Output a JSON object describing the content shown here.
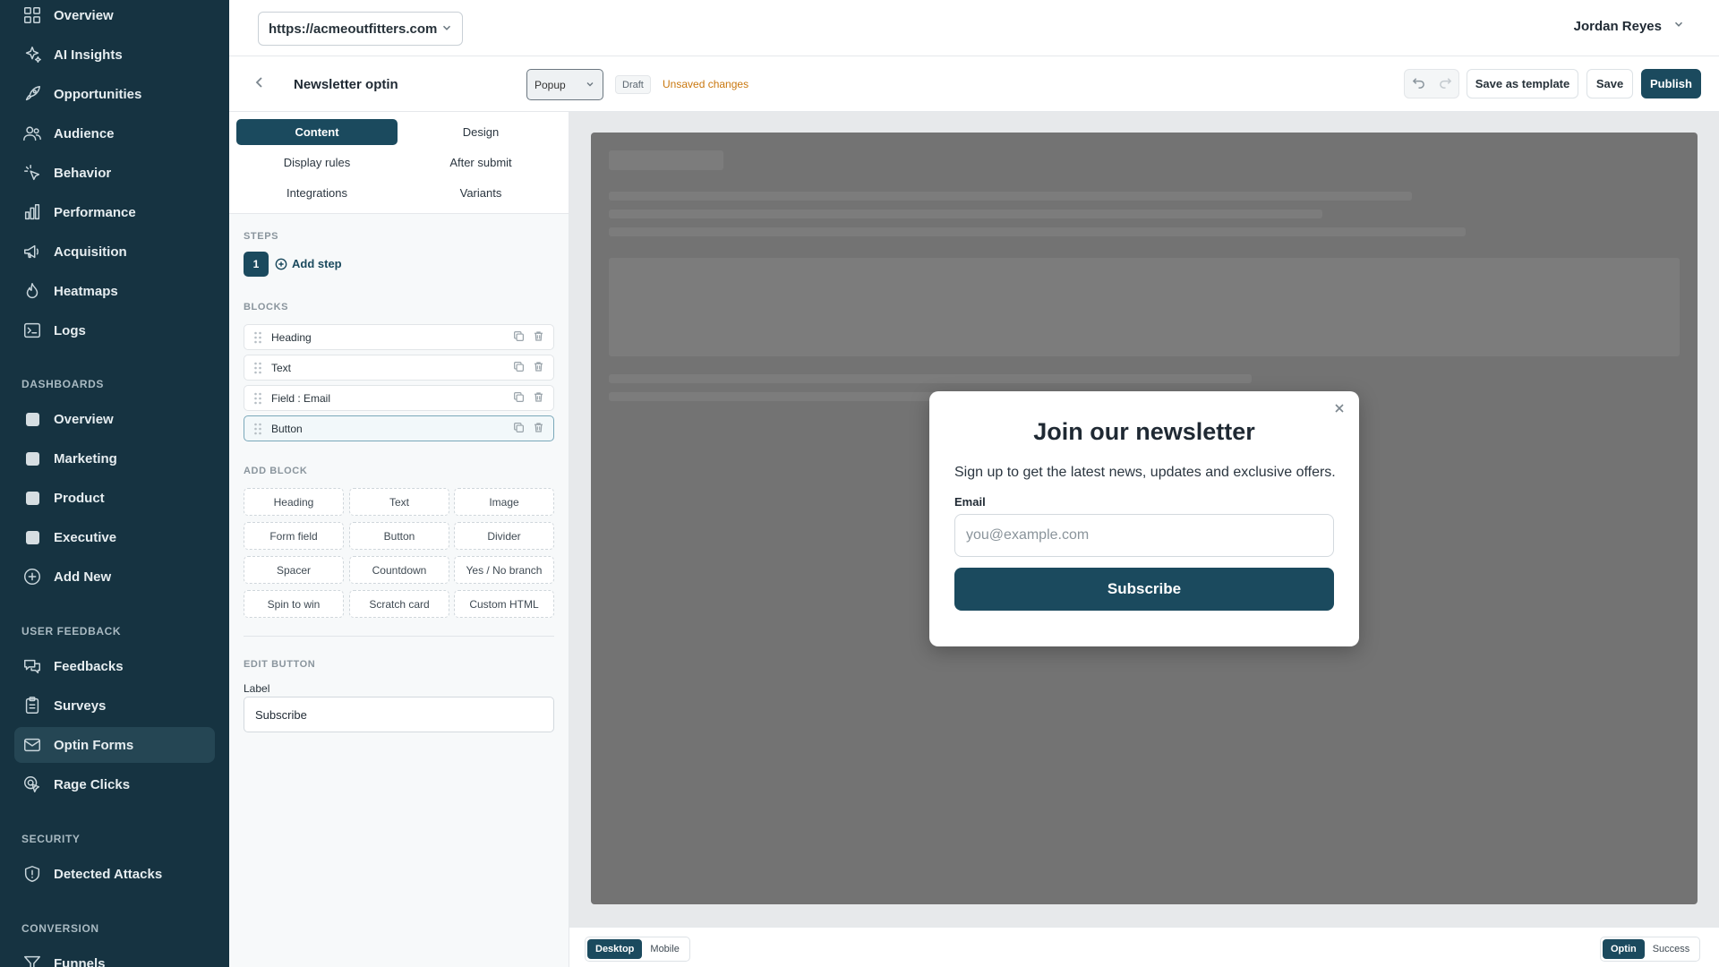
{
  "sidebar": {
    "items": [
      {
        "label": "Overview",
        "icon": "grid-icon"
      },
      {
        "label": "AI Insights",
        "icon": "sparkles-icon"
      },
      {
        "label": "Opportunities",
        "icon": "rocket-icon"
      },
      {
        "label": "Audience",
        "icon": "users-icon"
      },
      {
        "label": "Behavior",
        "icon": "cursor-click-icon"
      },
      {
        "label": "Performance",
        "icon": "bar-chart-icon"
      },
      {
        "label": "Acquisition",
        "icon": "megaphone-icon"
      },
      {
        "label": "Heatmaps",
        "icon": "flame-icon"
      },
      {
        "label": "Logs",
        "icon": "terminal-icon"
      }
    ],
    "dashboards_title": "DASHBOARDS",
    "dashboards": [
      {
        "label": "Overview"
      },
      {
        "label": "Marketing"
      },
      {
        "label": "Product"
      },
      {
        "label": "Executive"
      }
    ],
    "add_new": "Add New",
    "feedback_title": "USER FEEDBACK",
    "feedback": [
      {
        "label": "Feedbacks",
        "icon": "chat-icon"
      },
      {
        "label": "Surveys",
        "icon": "clipboard-icon"
      },
      {
        "label": "Optin Forms",
        "icon": "mail-icon",
        "active": true
      },
      {
        "label": "Rage Clicks",
        "icon": "rage-click-icon"
      }
    ],
    "security_title": "SECURITY",
    "security": [
      {
        "label": "Detected Attacks",
        "icon": "shield-icon"
      }
    ],
    "conversion_title": "CONVERSION",
    "conversion": [
      {
        "label": "Funnels",
        "icon": "funnel-icon"
      }
    ]
  },
  "topbar": {
    "site_url": "https://acmeoutfitters.com",
    "user_name": "Jordan Reyes"
  },
  "editor": {
    "title": "Newsletter optin",
    "form_type": "Popup",
    "status_badge": "Draft",
    "unsaved_text": "Unsaved changes",
    "save_template_label": "Save as template",
    "save_label": "Save",
    "publish_label": "Publish",
    "colors": {
      "primary": "#1b4a5e",
      "warning": "#c9770e"
    }
  },
  "panel": {
    "tabs": [
      {
        "label": "Content",
        "active": true
      },
      {
        "label": "Design"
      },
      {
        "label": "Display rules"
      },
      {
        "label": "After submit"
      },
      {
        "label": "Integrations"
      },
      {
        "label": "Variants"
      }
    ],
    "steps_title": "STEPS",
    "step_number": "1",
    "add_step_label": "Add step",
    "blocks_title": "BLOCKS",
    "blocks": [
      {
        "label": "Heading"
      },
      {
        "label": "Text"
      },
      {
        "label": "Field : Email"
      },
      {
        "label": "Button",
        "selected": true
      }
    ],
    "add_block_title": "ADD BLOCK",
    "add_block_options": [
      "Heading",
      "Text",
      "Image",
      "Form field",
      "Button",
      "Divider",
      "Spacer",
      "Countdown",
      "Yes / No branch",
      "Spin to win",
      "Scratch card",
      "Custom HTML"
    ],
    "edit_title": "EDIT BUTTON",
    "label_field_label": "Label",
    "label_field_value": "Subscribe"
  },
  "popup": {
    "heading": "Join our newsletter",
    "text": "Sign up to get the latest news, updates and exclusive offers.",
    "email_label": "Email",
    "email_placeholder": "you@example.com",
    "button_label": "Subscribe"
  },
  "bottombar": {
    "device_options": [
      "Desktop",
      "Mobile"
    ],
    "device_selected": "Desktop",
    "state_options": [
      "Optin",
      "Success"
    ],
    "state_selected": "Optin"
  }
}
